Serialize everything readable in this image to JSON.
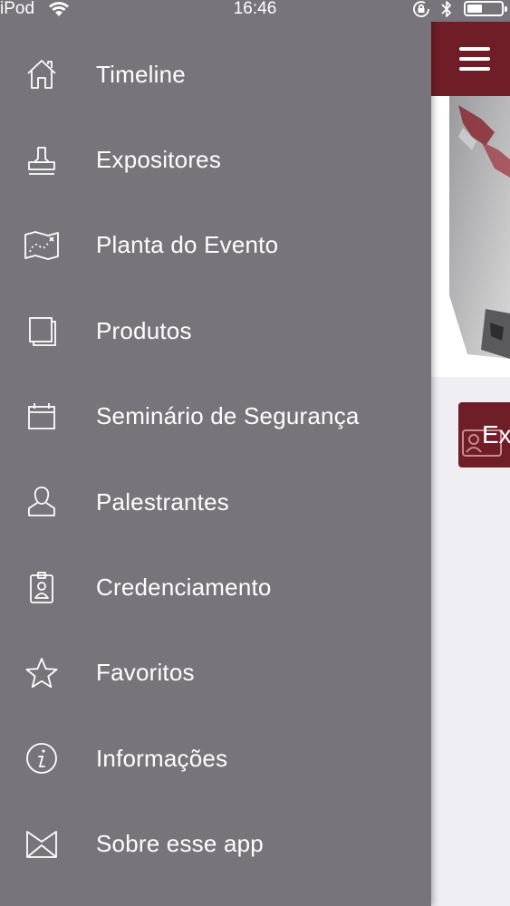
{
  "status_bar": {
    "carrier": "iPod",
    "time": "16:46"
  },
  "menu": {
    "items": [
      {
        "label": "Timeline",
        "icon": "home-icon"
      },
      {
        "label": "Expositores",
        "icon": "stamp-icon"
      },
      {
        "label": "Planta do Evento",
        "icon": "map-icon"
      },
      {
        "label": "Produtos",
        "icon": "pages-icon"
      },
      {
        "label": "Seminário de Segurança",
        "icon": "calendar-icon"
      },
      {
        "label": "Palestrantes",
        "icon": "person-icon"
      },
      {
        "label": "Credenciamento",
        "icon": "badge-icon"
      },
      {
        "label": "Favoritos",
        "icon": "star-icon"
      },
      {
        "label": "Informações",
        "icon": "info-icon"
      },
      {
        "label": "Sobre esse app",
        "icon": "envelope-icon"
      }
    ]
  },
  "background": {
    "expo_button_label": "Ex"
  },
  "colors": {
    "drawer_bg": "#777579",
    "brand": "#6f1e28",
    "content_bg": "#efeef2"
  }
}
